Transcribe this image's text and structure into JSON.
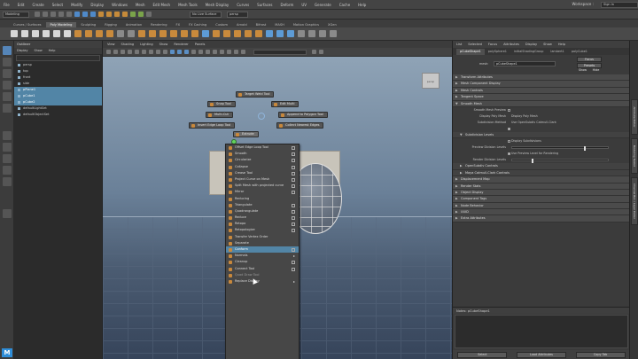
{
  "menubar": {
    "items": [
      "File",
      "Edit",
      "Create",
      "Select",
      "Modify",
      "Display",
      "Windows",
      "Mesh",
      "Edit Mesh",
      "Mesh Tools",
      "Mesh Display",
      "Curves",
      "Surfaces",
      "Deform",
      "UV",
      "Generate",
      "Cache",
      "Help"
    ],
    "workspace": "Workspace :",
    "user": "Sign In"
  },
  "statusline": {
    "mode": "Modeling",
    "symmetry": "No Live Surface",
    "camera": "persp"
  },
  "shelf": {
    "tabs": [
      "Curves / Surfaces",
      "Poly Modeling",
      "Sculpting",
      "Rigging",
      "Animation",
      "Rendering",
      "FX",
      "FX Caching",
      "Custom",
      "Arnold",
      "Bifrost",
      "MASH",
      "Motion Graphics",
      "XGen"
    ],
    "active_index": 1
  },
  "outliner": {
    "title": "Outliner",
    "menu": [
      "Display",
      "Show",
      "Help"
    ],
    "rows": [
      {
        "label": "persp",
        "selected": false
      },
      {
        "label": "top",
        "selected": false
      },
      {
        "label": "front",
        "selected": false
      },
      {
        "label": "side",
        "selected": false
      },
      {
        "label": "pPlane1",
        "selected": true
      },
      {
        "label": "pCube1",
        "selected": true
      },
      {
        "label": "pCube2",
        "selected": true
      },
      {
        "label": "defaultLightSet",
        "selected": false
      },
      {
        "label": "defaultObjectSet",
        "selected": false
      }
    ]
  },
  "viewport": {
    "menu": [
      "View",
      "Shading",
      "Lighting",
      "Show",
      "Renderer",
      "Panels"
    ],
    "view_cube_label": "persp"
  },
  "marking_menu": {
    "north": "Target Weld Tool",
    "northwest": "Snap Tool",
    "northeast": "Edit Multi",
    "west": "Multi-Cut",
    "east": "Append to Polygon Tool",
    "southwest": "Insert Edge Loop Tool",
    "southeast": "Collect Nearest Edges",
    "south": "Extrude"
  },
  "context_menu": {
    "items": [
      {
        "label": "Offset Edge Loop Tool",
        "box": true,
        "sub": false,
        "hl": false,
        "dim": false
      },
      {
        "label": "Smooth",
        "box": true,
        "sub": false,
        "hl": false,
        "dim": false
      },
      {
        "label": "Circularize",
        "box": true,
        "sub": false,
        "hl": false,
        "dim": false
      },
      {
        "label": "Collapse",
        "box": true,
        "sub": false,
        "hl": false,
        "dim": false
      },
      {
        "label": "Crease Tool",
        "box": true,
        "sub": false,
        "hl": false,
        "dim": false
      },
      {
        "label": "Project Curve on Mesh",
        "box": true,
        "sub": false,
        "hl": false,
        "dim": false
      },
      {
        "label": "Split Mesh with projected curve",
        "box": true,
        "sub": false,
        "hl": false,
        "dim": false
      },
      {
        "label": "Mirror",
        "box": true,
        "sub": false,
        "hl": false,
        "dim": false
      },
      {
        "label": "Reducing",
        "box": false,
        "sub": false,
        "hl": false,
        "dim": false
      },
      {
        "label": "Triangulate",
        "box": true,
        "sub": false,
        "hl": false,
        "dim": false
      },
      {
        "label": "Quadrangulate",
        "box": true,
        "sub": false,
        "hl": false,
        "dim": false
      },
      {
        "label": "Reduce",
        "box": true,
        "sub": false,
        "hl": false,
        "dim": false
      },
      {
        "label": "Retopo",
        "box": true,
        "sub": false,
        "hl": false,
        "dim": false
      },
      {
        "label": "Retopologize",
        "box": true,
        "sub": false,
        "hl": false,
        "dim": false
      },
      {
        "label": "Transfer Vertex Order",
        "box": false,
        "sub": false,
        "hl": false,
        "dim": false
      },
      {
        "label": "Separate",
        "box": false,
        "sub": false,
        "hl": false,
        "dim": false
      },
      {
        "label": "Conform",
        "box": true,
        "sub": false,
        "hl": true,
        "dim": false
      },
      {
        "label": "Normals",
        "box": false,
        "sub": true,
        "hl": false,
        "dim": false
      },
      {
        "label": "Cleanup",
        "box": true,
        "sub": false,
        "hl": false,
        "dim": false
      },
      {
        "label": "Connect Tool",
        "box": true,
        "sub": false,
        "hl": false,
        "dim": false
      },
      {
        "label": "Quad Draw Tool",
        "box": false,
        "sub": false,
        "hl": false,
        "dim": true
      },
      {
        "label": "Replace Display",
        "box": false,
        "sub": true,
        "hl": false,
        "dim": false
      }
    ]
  },
  "attribute_editor": {
    "menu": [
      "List",
      "Selected",
      "Focus",
      "Attributes",
      "Display",
      "Show",
      "Help"
    ],
    "tabs": [
      "pCubeShape1",
      "polySphere1",
      "initialShadingGroup",
      "lambert1",
      "polyCube1"
    ],
    "node_tab": "pCubeShape1",
    "mesh_label": "mesh:",
    "mesh_value": "pCubeShape1",
    "focus_btn": "Focus",
    "presets_btn": "Presets",
    "show_btn": "Show",
    "hide_btn": "Hide",
    "sections": [
      {
        "label": "Transform Attributes",
        "sub": false
      },
      {
        "label": "Mesh Component Display",
        "sub": false
      },
      {
        "label": "Mesh Controls",
        "sub": false
      },
      {
        "label": "Tangent Space",
        "sub": false
      },
      {
        "label": "Smooth Mesh",
        "sub": false
      }
    ],
    "smooth_attrs": [
      {
        "label": "Smooth Mesh Preview",
        "kind": "chk",
        "on": false
      },
      {
        "label": "Display Poly Mesh",
        "kind": "text",
        "value": "Display Poly Mesh"
      },
      {
        "label": "Subdivision Method",
        "kind": "text",
        "value": "Use OpenSubdiv Catmull-Clark"
      },
      {
        "label": "",
        "kind": "chk",
        "on": true
      },
      {
        "label": "OpenSubdiv Controls",
        "kind": "section"
      }
    ],
    "subdiv_section": "Subdivision Levels",
    "subdiv_attrs": [
      {
        "label": "",
        "kind": "chk",
        "on": false,
        "value": "Display Subdivisions"
      },
      {
        "label": "Preview Division Levels",
        "kind": "slider",
        "pos": 0.75
      },
      {
        "label": "",
        "kind": "chk",
        "on": true,
        "value": "Use Preview Level for Rendering"
      },
      {
        "label": "Render Division Levels",
        "kind": "slider",
        "pos": 0.2
      }
    ],
    "lower_sections": [
      {
        "label": "OpenSubdiv Controls",
        "sub": true
      },
      {
        "label": "Maya Catmull-Clark Controls",
        "sub": true
      },
      {
        "label": "Displacement Map",
        "sub": false
      },
      {
        "label": "Render Stats",
        "sub": false
      },
      {
        "label": "Object Display",
        "sub": false
      },
      {
        "label": "Component Tags",
        "sub": false
      },
      {
        "label": "Node Behavior",
        "sub": false
      },
      {
        "label": "UUID",
        "sub": false
      },
      {
        "label": "Extra Attributes",
        "sub": false
      }
    ],
    "notes_label": "Notes: pCubeShape1",
    "bottom_buttons": [
      "Select",
      "Load Attributes",
      "Copy Tab"
    ]
  },
  "side_tabs": [
    "Attribute Editor",
    "Modeling Toolkit",
    "Channel Box / Layer Editor"
  ]
}
